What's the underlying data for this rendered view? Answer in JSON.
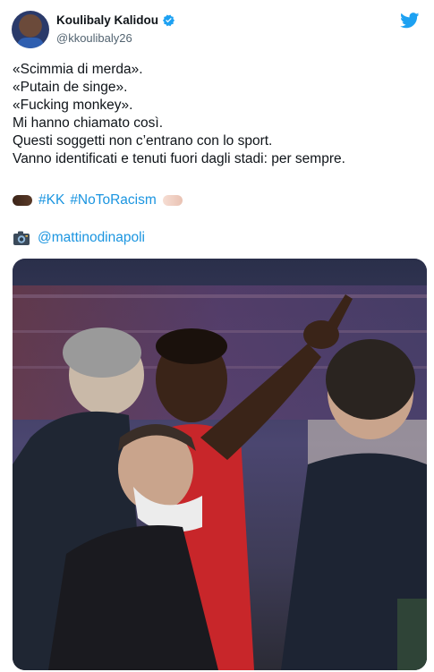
{
  "tweet": {
    "author": {
      "display_name": "Koulibaly Kalidou",
      "handle": "@kkoulibaly26",
      "verified": true
    },
    "lines": [
      "«Scimmia di merda».",
      "«Putain de singe».",
      "«Fucking monkey».",
      "Mi hanno chiamato così.",
      "Questi soggetti non c’entrano con lo sport.",
      "Vanno identificati e tenuti fuori dagli stadi: per sempre."
    ],
    "hashtags": [
      "#KK",
      "#NoToRacism"
    ],
    "photo_credit": "@mattinodinapoli",
    "icons": {
      "platform": "twitter-bird-icon",
      "verified": "verified-badge-icon",
      "camera": "camera-icon",
      "fist_left": "fist-bump-dark-icon",
      "fist_right": "fist-bump-light-icon"
    },
    "colors": {
      "link": "#1b95e0",
      "twitter_blue": "#1da1f2",
      "text": "#0f1419",
      "muted": "#536471"
    }
  }
}
